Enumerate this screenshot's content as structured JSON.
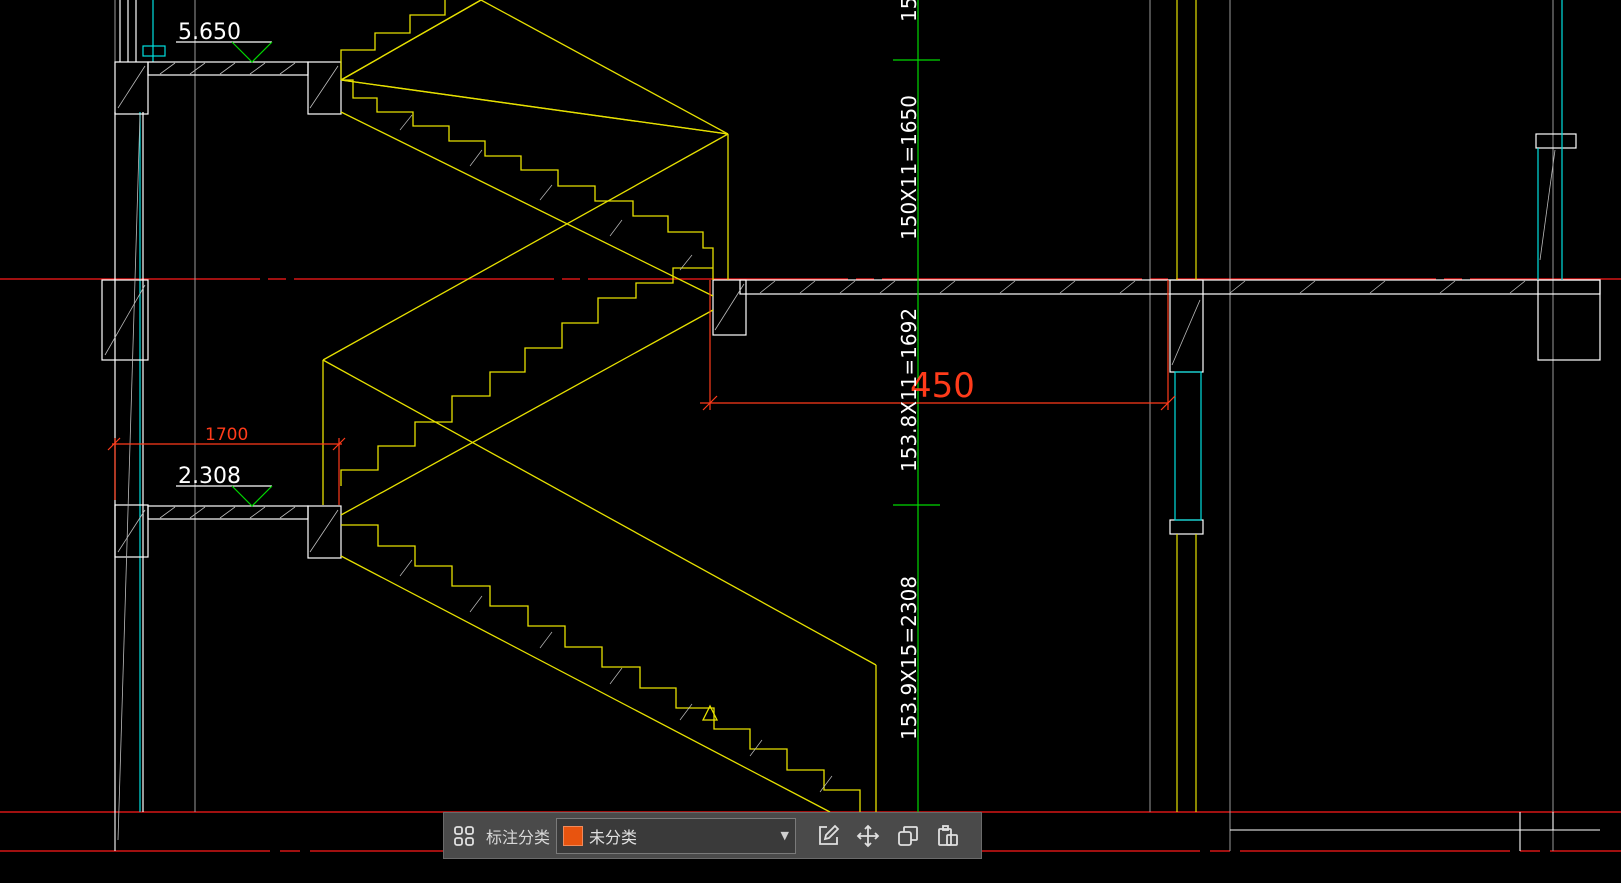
{
  "drawing": {
    "levels": [
      "5.650",
      "2.308"
    ],
    "dimension_1700": "1700",
    "dimension_450": "450",
    "stair_dims": [
      "150X11=1650",
      "153.8X11=1692",
      "153.9X15=2308"
    ],
    "stair_top_partial": "15",
    "colors": {
      "background": "#000000",
      "stair": "#e6e000",
      "structure": "#ffffff",
      "dimension_red": "#ff3b1a",
      "axis": "#ff0000",
      "level_green": "#00ff00",
      "glass": "#00e0e0"
    }
  },
  "toolbar": {
    "grid_icon": "grid-icon",
    "category_label": "标注分类",
    "category_value": "未分类",
    "category_color": "#e8540f",
    "edit_icon": "edit-icon",
    "move_icon": "move-icon",
    "copy_icon": "copy-icon",
    "paste_icon": "paste-icon"
  }
}
